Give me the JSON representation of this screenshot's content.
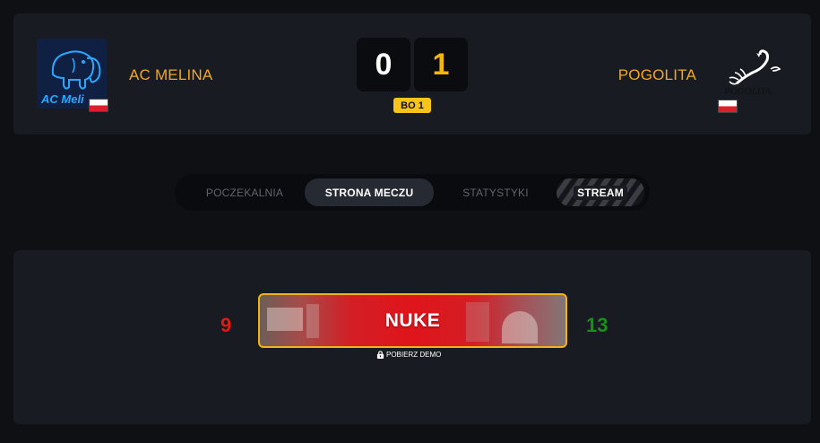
{
  "colors": {
    "accent": "#f5a623",
    "score_right": "#f5b50a",
    "badge": "#f6c31b",
    "loss": "#e01818",
    "win": "#1a8f1a",
    "map_border": "#f2b21c"
  },
  "match": {
    "team_left": {
      "name": "AC MELINA",
      "logo_text": "AC Meli",
      "flag": "poland-flag"
    },
    "team_right": {
      "name": "POGOLITA",
      "logo_text": "POGOLITA",
      "flag": "poland-flag"
    },
    "score_left": "0",
    "score_right": "1",
    "format": "BO 1"
  },
  "tabs": [
    {
      "label": "POCZEKALNIA",
      "active": false
    },
    {
      "label": "STRONA MECZU",
      "active": true
    },
    {
      "label": "STATYSTYKI",
      "active": false
    },
    {
      "label": "STREAM",
      "active": false
    }
  ],
  "maps": [
    {
      "name": "NUKE",
      "score_left": "9",
      "score_right": "13",
      "demo_label": "POBIERZ DEMO",
      "demo_icon": "lock-icon"
    }
  ]
}
